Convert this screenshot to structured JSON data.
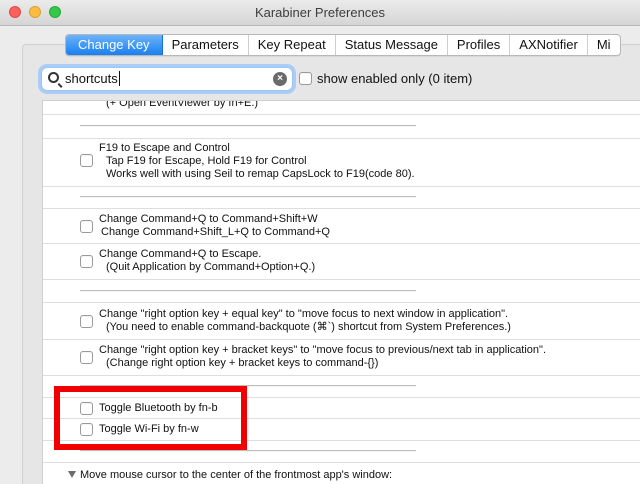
{
  "window": {
    "title": "Karabiner Preferences"
  },
  "tabs": [
    {
      "label": "Change Key",
      "active": true
    },
    {
      "label": "Parameters"
    },
    {
      "label": "Key Repeat"
    },
    {
      "label": "Status Message"
    },
    {
      "label": "Profiles"
    },
    {
      "label": "AXNotifier"
    },
    {
      "label": "Mi"
    }
  ],
  "search": {
    "value": "shortcuts",
    "clear_icon": "clear-icon",
    "icon": "search-icon"
  },
  "filter": {
    "label": "show enabled only (0 item)",
    "checked": false
  },
  "items": [
    {
      "lines": [
        "(+ Open EventViewer by fn+E.)"
      ]
    },
    {
      "lines": [
        "F19 to Escape and Control",
        "Tap F19 for Escape, Hold F19 for Control",
        "Works well with using Seil to remap CapsLock to F19(code 80)."
      ]
    },
    {
      "lines": [
        "Change Command+Q to Command+Shift+W",
        "Change Command+Shift_L+Q to Command+Q"
      ]
    },
    {
      "lines": [
        "Change Command+Q to Escape.",
        "(Quit Application by Command+Option+Q.)"
      ]
    },
    {
      "lines": [
        "Change \"right option key + equal key\" to \"move focus to next window in application\".",
        "(You need to enable command-backquote (⌘`) shortcut from System Preferences.)"
      ]
    },
    {
      "lines": [
        "Change \"right option key + bracket keys\" to \"move focus to previous/next tab in application\".",
        "(Change right option key + bracket keys to command-{})"
      ]
    },
    {
      "lines": [
        "Toggle Bluetooth by fn-b"
      ]
    },
    {
      "lines": [
        "Toggle Wi-Fi by fn-w"
      ]
    }
  ],
  "footer": {
    "label": "Move mouse cursor to the center of the frontmost app's window:"
  },
  "colors": {
    "accent": "#1a7ff0",
    "highlight_box": "#f00000"
  }
}
